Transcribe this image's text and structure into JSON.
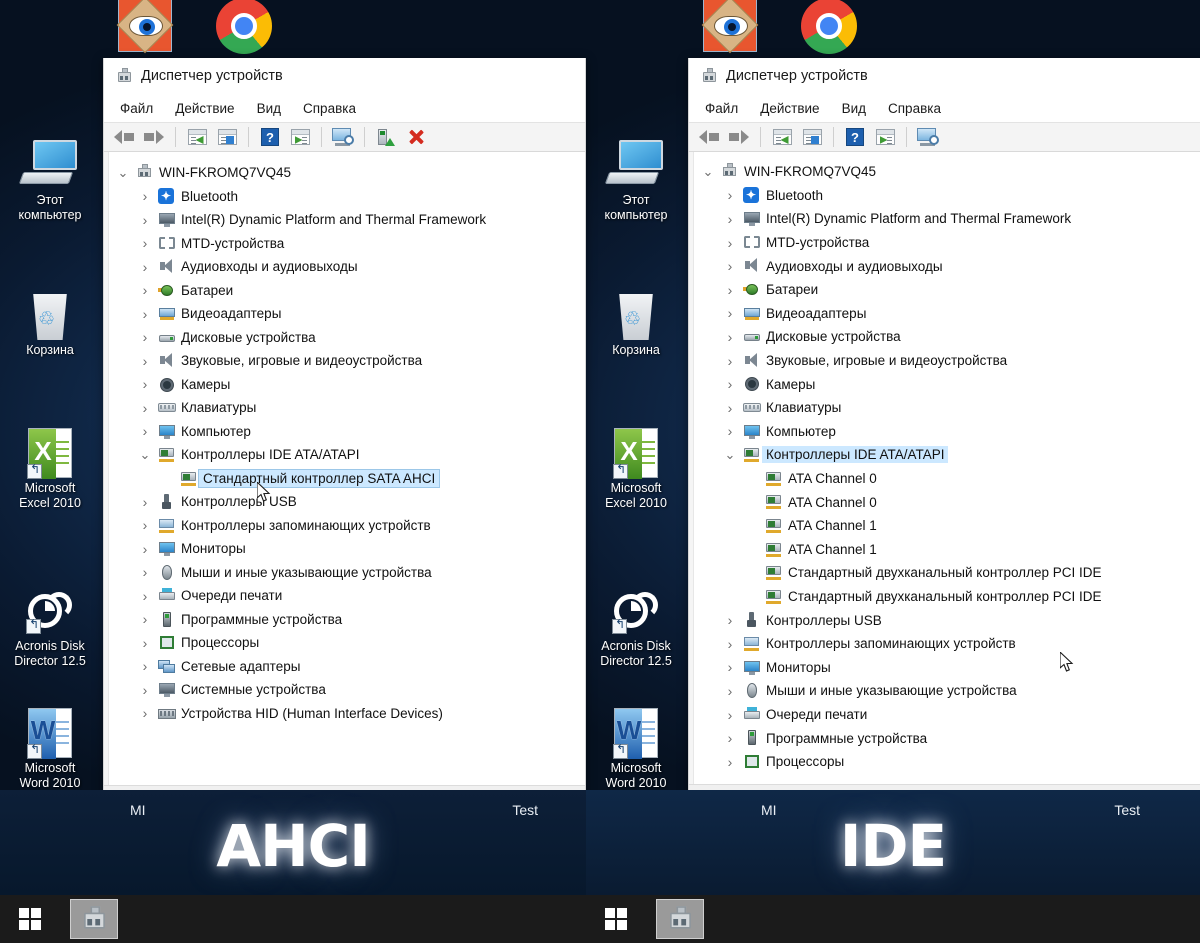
{
  "desktop": {
    "top_pinned": [
      {
        "name": "faststone-image-viewer",
        "label": "FastStone Image Viewer"
      },
      {
        "name": "google-chrome",
        "label": "Google Chrome"
      }
    ],
    "icons": [
      {
        "id": "this-pc",
        "label": "Этот\nкомпьютер",
        "line1": "Этот",
        "line2": "компьютер"
      },
      {
        "id": "recycle",
        "label": "Корзина",
        "line1": "Корзина",
        "line2": ""
      },
      {
        "id": "excel",
        "label": "Microsoft Excel 2010",
        "line1": "Microsoft",
        "line2": "Excel 2010"
      },
      {
        "id": "acronis",
        "label": "Acronis Disk Director 12.5",
        "line1": "Acronis Disk",
        "line2": "Director 12.5"
      },
      {
        "id": "word",
        "label": "Microsoft Word 2010",
        "line1": "Microsoft",
        "line2": "Word 2010"
      }
    ]
  },
  "window": {
    "title": "Диспетчер устройств",
    "menu": [
      "Файл",
      "Действие",
      "Вид",
      "Справка"
    ],
    "toolbar_tooltips": [
      "Назад",
      "Вперед",
      "Свойства",
      "Обновить конфигурацию оборудования",
      "Справка",
      "Показать скрытые устройства",
      "Обновить драйвер",
      "Отключить устройство",
      "Удалить устройство"
    ],
    "root": "WIN-FKROMQ7VQ45"
  },
  "left_panel": {
    "caption_big": "AHCI",
    "caption_mi": "MI",
    "caption_test": "Test",
    "tree": [
      {
        "label": "WIN-FKROMQ7VQ45",
        "level": 0,
        "icon": "computer-node-icon",
        "expander": "v",
        "selected": false
      },
      {
        "label": "Bluetooth",
        "level": 1,
        "icon": "bluetooth-icon",
        "expander": ">",
        "selected": false
      },
      {
        "label": "Intel(R) Dynamic Platform and Thermal Framework",
        "level": 1,
        "icon": "system-device-icon",
        "expander": ">",
        "selected": false
      },
      {
        "label": "MTD-устройства",
        "level": 1,
        "icon": "mtd-icon",
        "expander": ">",
        "selected": false
      },
      {
        "label": "Аудиовходы и аудиовыходы",
        "level": 1,
        "icon": "speaker-icon",
        "expander": ">",
        "selected": false
      },
      {
        "label": "Батареи",
        "level": 1,
        "icon": "battery-icon",
        "expander": ">",
        "selected": false
      },
      {
        "label": "Видеоадаптеры",
        "level": 1,
        "icon": "display-adapter-icon",
        "expander": ">",
        "selected": false
      },
      {
        "label": "Дисковые устройства",
        "level": 1,
        "icon": "disk-drive-icon",
        "expander": ">",
        "selected": false
      },
      {
        "label": "Звуковые, игровые и видеоустройства",
        "level": 1,
        "icon": "speaker-icon",
        "expander": ">",
        "selected": false
      },
      {
        "label": "Камеры",
        "level": 1,
        "icon": "camera-icon",
        "expander": ">",
        "selected": false
      },
      {
        "label": "Клавиатуры",
        "level": 1,
        "icon": "keyboard-icon",
        "expander": ">",
        "selected": false
      },
      {
        "label": "Компьютер",
        "level": 1,
        "icon": "monitor-icon",
        "expander": ">",
        "selected": false
      },
      {
        "label": "Контроллеры IDE ATA/ATAPI",
        "level": 1,
        "icon": "ide-controller-icon",
        "expander": "v",
        "selected": false
      },
      {
        "label": "Стандартный контроллер SATA AHCI",
        "level": 2,
        "icon": "ide-controller-icon",
        "expander": "",
        "selected": true
      },
      {
        "label": "Контроллеры USB",
        "level": 1,
        "icon": "usb-icon",
        "expander": ">",
        "selected": false
      },
      {
        "label": "Контроллеры запоминающих устройств",
        "level": 1,
        "icon": "storage-controller-icon",
        "expander": ">",
        "selected": false
      },
      {
        "label": "Мониторы",
        "level": 1,
        "icon": "monitor-icon",
        "expander": ">",
        "selected": false
      },
      {
        "label": "Мыши и иные указывающие устройства",
        "level": 1,
        "icon": "mouse-icon",
        "expander": ">",
        "selected": false
      },
      {
        "label": "Очереди печати",
        "level": 1,
        "icon": "printer-icon",
        "expander": ">",
        "selected": false
      },
      {
        "label": "Программные устройства",
        "level": 1,
        "icon": "software-device-icon",
        "expander": ">",
        "selected": false
      },
      {
        "label": "Процессоры",
        "level": 1,
        "icon": "cpu-icon",
        "expander": ">",
        "selected": false
      },
      {
        "label": "Сетевые адаптеры",
        "level": 1,
        "icon": "network-adapter-icon",
        "expander": ">",
        "selected": false
      },
      {
        "label": "Системные устройства",
        "level": 1,
        "icon": "system-device-icon",
        "expander": ">",
        "selected": false
      },
      {
        "label": "Устройства HID (Human Interface Devices)",
        "level": 1,
        "icon": "hid-icon",
        "expander": ">",
        "selected": false
      }
    ]
  },
  "right_panel": {
    "caption_big": "IDE",
    "caption_mi": "MI",
    "caption_test": "Test",
    "tree": [
      {
        "label": "WIN-FKROMQ7VQ45",
        "level": 0,
        "icon": "computer-node-icon",
        "expander": "v",
        "selected": false
      },
      {
        "label": "Bluetooth",
        "level": 1,
        "icon": "bluetooth-icon",
        "expander": ">",
        "selected": false
      },
      {
        "label": "Intel(R) Dynamic Platform and Thermal Framework",
        "level": 1,
        "icon": "system-device-icon",
        "expander": ">",
        "selected": false
      },
      {
        "label": "MTD-устройства",
        "level": 1,
        "icon": "mtd-icon",
        "expander": ">",
        "selected": false
      },
      {
        "label": "Аудиовходы и аудиовыходы",
        "level": 1,
        "icon": "speaker-icon",
        "expander": ">",
        "selected": false
      },
      {
        "label": "Батареи",
        "level": 1,
        "icon": "battery-icon",
        "expander": ">",
        "selected": false
      },
      {
        "label": "Видеоадаптеры",
        "level": 1,
        "icon": "display-adapter-icon",
        "expander": ">",
        "selected": false
      },
      {
        "label": "Дисковые устройства",
        "level": 1,
        "icon": "disk-drive-icon",
        "expander": ">",
        "selected": false
      },
      {
        "label": "Звуковые, игровые и видеоустройства",
        "level": 1,
        "icon": "speaker-icon",
        "expander": ">",
        "selected": false
      },
      {
        "label": "Камеры",
        "level": 1,
        "icon": "camera-icon",
        "expander": ">",
        "selected": false
      },
      {
        "label": "Клавиатуры",
        "level": 1,
        "icon": "keyboard-icon",
        "expander": ">",
        "selected": false
      },
      {
        "label": "Компьютер",
        "level": 1,
        "icon": "monitor-icon",
        "expander": ">",
        "selected": false
      },
      {
        "label": "Контроллеры IDE ATA/ATAPI",
        "level": 1,
        "icon": "ide-controller-icon",
        "expander": "v",
        "selected": true
      },
      {
        "label": "ATA Channel 0",
        "level": 2,
        "icon": "ide-controller-icon",
        "expander": "",
        "selected": false
      },
      {
        "label": "ATA Channel 0",
        "level": 2,
        "icon": "ide-controller-icon",
        "expander": "",
        "selected": false
      },
      {
        "label": "ATA Channel 1",
        "level": 2,
        "icon": "ide-controller-icon",
        "expander": "",
        "selected": false
      },
      {
        "label": "ATA Channel 1",
        "level": 2,
        "icon": "ide-controller-icon",
        "expander": "",
        "selected": false
      },
      {
        "label": "Стандартный двухканальный контроллер PCI IDE",
        "level": 2,
        "icon": "ide-controller-icon",
        "expander": "",
        "selected": false
      },
      {
        "label": "Стандартный двухканальный контроллер PCI IDE",
        "level": 2,
        "icon": "ide-controller-icon",
        "expander": "",
        "selected": false
      },
      {
        "label": "Контроллеры USB",
        "level": 1,
        "icon": "usb-icon",
        "expander": ">",
        "selected": false
      },
      {
        "label": "Контроллеры запоминающих устройств",
        "level": 1,
        "icon": "storage-controller-icon",
        "expander": ">",
        "selected": false
      },
      {
        "label": "Мониторы",
        "level": 1,
        "icon": "monitor-icon",
        "expander": ">",
        "selected": false
      },
      {
        "label": "Мыши и иные указывающие устройства",
        "level": 1,
        "icon": "mouse-icon",
        "expander": ">",
        "selected": false
      },
      {
        "label": "Очереди печати",
        "level": 1,
        "icon": "printer-icon",
        "expander": ">",
        "selected": false
      },
      {
        "label": "Программные устройства",
        "level": 1,
        "icon": "software-device-icon",
        "expander": ">",
        "selected": false
      },
      {
        "label": "Процессоры",
        "level": 1,
        "icon": "cpu-icon",
        "expander": ">",
        "selected": false
      }
    ]
  },
  "taskbar": {
    "start_label": "Пуск",
    "apps": [
      {
        "name": "device-manager",
        "label": "Диспетчер устройств"
      }
    ]
  },
  "colors": {
    "selection": "#cce8ff",
    "toolbar_bg": "#f4f4f4",
    "window_bg": "#ffffff",
    "desktop": "#0d2240",
    "taskbar": "#1b1b1b",
    "accent_red": "#d42b1f",
    "accent_blue": "#1d5fae"
  }
}
